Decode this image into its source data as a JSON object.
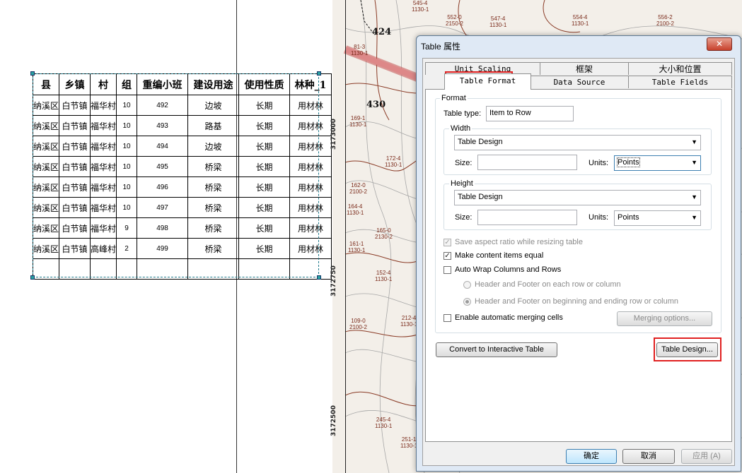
{
  "table": {
    "headers": [
      "县",
      "乡镇",
      "村",
      "组",
      "重编小班",
      "建设用途",
      "使用性质",
      "林种_1"
    ],
    "rows": [
      [
        "纳溪区",
        "白节镇",
        "福华村",
        "10",
        "492",
        "边坡",
        "长期",
        "用材林"
      ],
      [
        "纳溪区",
        "白节镇",
        "福华村",
        "10",
        "493",
        "路基",
        "长期",
        "用材林"
      ],
      [
        "纳溪区",
        "白节镇",
        "福华村",
        "10",
        "494",
        "边坡",
        "长期",
        "用材林"
      ],
      [
        "纳溪区",
        "白节镇",
        "福华村",
        "10",
        "495",
        "桥梁",
        "长期",
        "用材林"
      ],
      [
        "纳溪区",
        "白节镇",
        "福华村",
        "10",
        "496",
        "桥梁",
        "长期",
        "用材林"
      ],
      [
        "纳溪区",
        "白节镇",
        "福华村",
        "10",
        "497",
        "桥梁",
        "长期",
        "用材林"
      ],
      [
        "纳溪区",
        "白节镇",
        "福华村",
        "9",
        "498",
        "桥梁",
        "长期",
        "用材林"
      ],
      [
        "纳溪区",
        "白节镇",
        "高峰村",
        "2",
        "499",
        "桥梁",
        "长期",
        "用材林"
      ],
      [
        "",
        "",
        "",
        "",
        "",
        "",
        "",
        ""
      ]
    ]
  },
  "map": {
    "y_labels": [
      "3173000",
      "3172750",
      "3172500"
    ],
    "parcel_numbers": [
      "424",
      "430"
    ],
    "parcel_labels": [
      "545-4\n1130-1",
      "552-0\n2150-2",
      "547-4\n1130-1",
      "554-4\n1130-1",
      "556-2\n2100-2",
      "81-3\n1130-1",
      "169-1\n1130-1",
      "172-4\n1130-1",
      "162-0\n2100-2",
      "164-4\n1130-1",
      "165-0\n2130-2",
      "161-1\n1130-1",
      "152-4\n1130-1",
      "109-0\n2100-2",
      "212-4\n1130-1",
      "245-4\n1130-1",
      "251-1\n1130-1"
    ]
  },
  "dialog": {
    "title": "Table 属性",
    "close_label": "✕",
    "tabs_row1": [
      "Unit Scaling",
      "框架",
      "大小和位置"
    ],
    "tabs_row2": [
      "Table Format",
      "Data Source",
      "Table Fields"
    ],
    "active_tab": "Table Format",
    "format": {
      "group_label": "Format",
      "table_type_label": "Table type:",
      "table_type_value": "Item to Row",
      "width": {
        "group_label": "Width",
        "combo_value": "Table Design",
        "size_label": "Size:",
        "size_value": "",
        "units_label": "Units:",
        "units_value": "Points"
      },
      "height": {
        "group_label": "Height",
        "combo_value": "Table Design",
        "size_label": "Size:",
        "size_value": "",
        "units_label": "Units:",
        "units_value": "Points"
      },
      "save_aspect_label": "Save aspect ratio while resizing table",
      "save_aspect_checked": true,
      "make_equal_label": "Make content items equal",
      "make_equal_checked": true,
      "auto_wrap_label": "Auto Wrap Columns and Rows",
      "auto_wrap_checked": false,
      "radio_each_label": "Header and Footer on each row or column",
      "radio_begin_end_label": "Header and Footer on beginning and ending row or column",
      "auto_merge_label": "Enable automatic merging cells",
      "auto_merge_checked": false,
      "merging_options_label": "Merging options..."
    },
    "convert_button_label": "Convert to Interactive Table",
    "table_design_button_label": "Table Design...",
    "ok_label": "确定",
    "cancel_label": "取消",
    "apply_label": "应用 (A)",
    "highlight_color": "#e02020"
  }
}
